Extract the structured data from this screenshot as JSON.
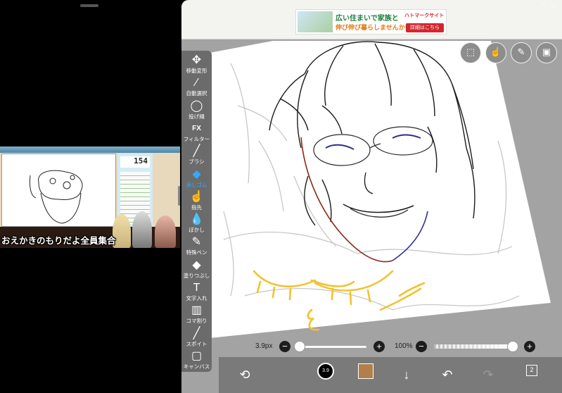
{
  "video": {
    "timer": "154",
    "caption": "おえかきのもりだよ全員集合"
  },
  "ad": {
    "headline": "広い住まいで家族と",
    "subline": "伸び伸び暮らしませんか!",
    "brand": "ハトマークサイト",
    "cta": "詳細はこちら"
  },
  "tools": [
    {
      "label": "移動変形",
      "icon": "move-icon",
      "glyph": "✥"
    },
    {
      "label": "自動選択",
      "icon": "magic-wand-icon",
      "glyph": "⁄"
    },
    {
      "label": "投げ縄",
      "icon": "lasso-icon",
      "glyph": "◯"
    },
    {
      "label": "フィルター",
      "icon": "fx-icon",
      "glyph": "FX"
    },
    {
      "label": "ブラシ",
      "icon": "brush-icon",
      "glyph": "╱"
    },
    {
      "label": "消しゴム",
      "icon": "eraser-icon",
      "glyph": "◆"
    },
    {
      "label": "指先",
      "icon": "finger-icon",
      "glyph": "☝"
    },
    {
      "label": "ぼかし",
      "icon": "blur-drop-icon",
      "glyph": "💧"
    },
    {
      "label": "特殊ペン",
      "icon": "special-pen-icon",
      "glyph": "✎"
    },
    {
      "label": "塗りつぶし",
      "icon": "fill-icon",
      "glyph": "◆"
    },
    {
      "label": "文字入れ",
      "icon": "text-icon",
      "glyph": "T"
    },
    {
      "label": "コマ割り",
      "icon": "frame-divide-icon",
      "glyph": "▥"
    },
    {
      "label": "スポイト",
      "icon": "eyedropper-icon",
      "glyph": "╱"
    },
    {
      "label": "キャンバス",
      "icon": "canvas-icon",
      "glyph": "▢"
    }
  ],
  "active_tool_index": 5,
  "brush_size": {
    "label": "3.9px",
    "level": 0.05
  },
  "opacity": {
    "label": "100%",
    "level": 1.0
  },
  "brush_preview": "3.9",
  "layer_count": "2",
  "colors": {
    "current": "#b27f4a",
    "active_tool": "#3aa7f5",
    "line_yellow": "#f2c230",
    "line_red": "#8a2a1c",
    "line_blue": "#2d2f8a"
  }
}
